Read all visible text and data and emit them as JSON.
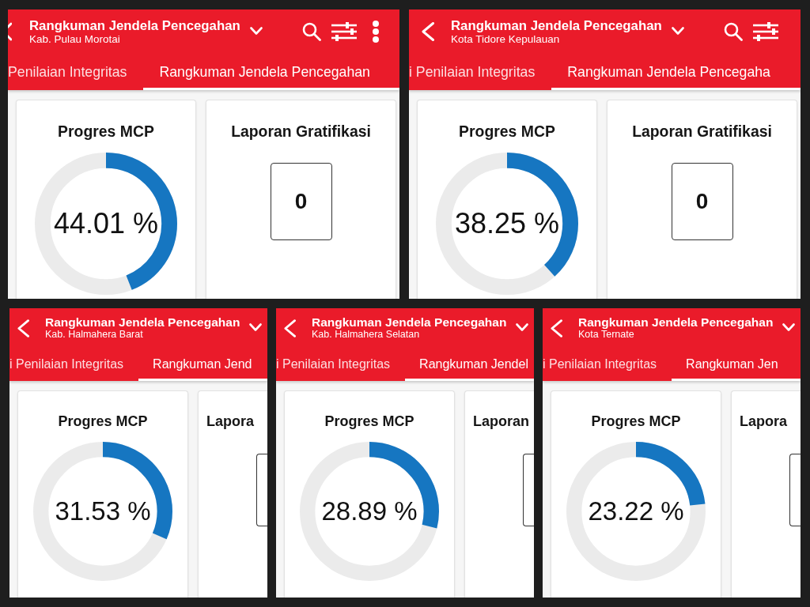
{
  "rows": [
    {
      "panels": [
        {
          "header": {
            "back_button": {
              "cut": true
            },
            "title": "Rangkuman Jendela Pencegahan",
            "subtitle": "Kab. Pulau Morotai",
            "actions": [
              {
                "kind": "search"
              },
              {
                "kind": "filter"
              },
              {
                "kind": "more"
              }
            ]
          },
          "tabs": [
            {
              "label": "Penilaian Integritas",
              "selected": false
            },
            {
              "label": "Rangkuman Jendela Pencegahan",
              "selected": true
            }
          ],
          "progress_card": {
            "title": "Progres MCP",
            "value": "44.01 %",
            "level": 0.4401
          },
          "gratifikasi_card": {
            "title": "Laporan Gratifikasi",
            "count": "0"
          }
        },
        {
          "header": {
            "back_button": {
              "cut": false
            },
            "title": "Rangkuman Jendela Pencegahan",
            "subtitle": "Kota Tidore Kepulauan",
            "actions": [
              {
                "kind": "search"
              },
              {
                "kind": "filter"
              }
            ]
          },
          "tabs": [
            {
              "label": "i Penilaian Integritas",
              "selected": false
            },
            {
              "label": "Rangkuman Jendela Pencegaha",
              "selected": true
            }
          ],
          "progress_card": {
            "title": "Progres MCP",
            "value": "38.25 %",
            "level": 0.3825
          },
          "gratifikasi_card": {
            "title": "Laporan Gratifikasi",
            "count": "0"
          }
        }
      ]
    },
    {
      "panels": [
        {
          "header": {
            "back_button": {
              "cut": false
            },
            "title": "Rangkuman Jendela Pencegahan",
            "subtitle": "Kab. Halmahera Barat"
          },
          "tabs": [
            {
              "label": "i Penilaian Integritas",
              "selected": false
            },
            {
              "label": "Rangkuman Jend",
              "selected": true
            }
          ],
          "progress_card": {
            "title": "Progres MCP",
            "value": "31.53 %",
            "level": 0.3153
          },
          "gratifikasi_card": {
            "title": "Lapora"
          }
        },
        {
          "header": {
            "back_button": {
              "cut": false
            },
            "title": "Rangkuman Jendela Pencegahan",
            "subtitle": "Kab. Halmahera Selatan"
          },
          "tabs": [
            {
              "label": "i Penilaian Integritas",
              "selected": false
            },
            {
              "label": "Rangkuman Jendel",
              "selected": true
            }
          ],
          "progress_card": {
            "title": "Progres MCP",
            "value": "28.89 %",
            "level": 0.2889
          },
          "gratifikasi_card": {
            "title": "Laporan"
          }
        },
        {
          "header": {
            "back_button": {
              "cut": false
            },
            "title": "Rangkuman Jendela Pencegahan",
            "subtitle": "Kota Ternate"
          },
          "tabs": [
            {
              "label": "i Penilaian Integritas",
              "selected": false
            },
            {
              "label": "Rangkuman Jen",
              "selected": true
            }
          ],
          "progress_card": {
            "title": "Progres MCP",
            "value": "23.22 %",
            "level": 0.2322
          },
          "gratifikasi_card": {
            "title": "Lapora"
          }
        }
      ]
    }
  ]
}
